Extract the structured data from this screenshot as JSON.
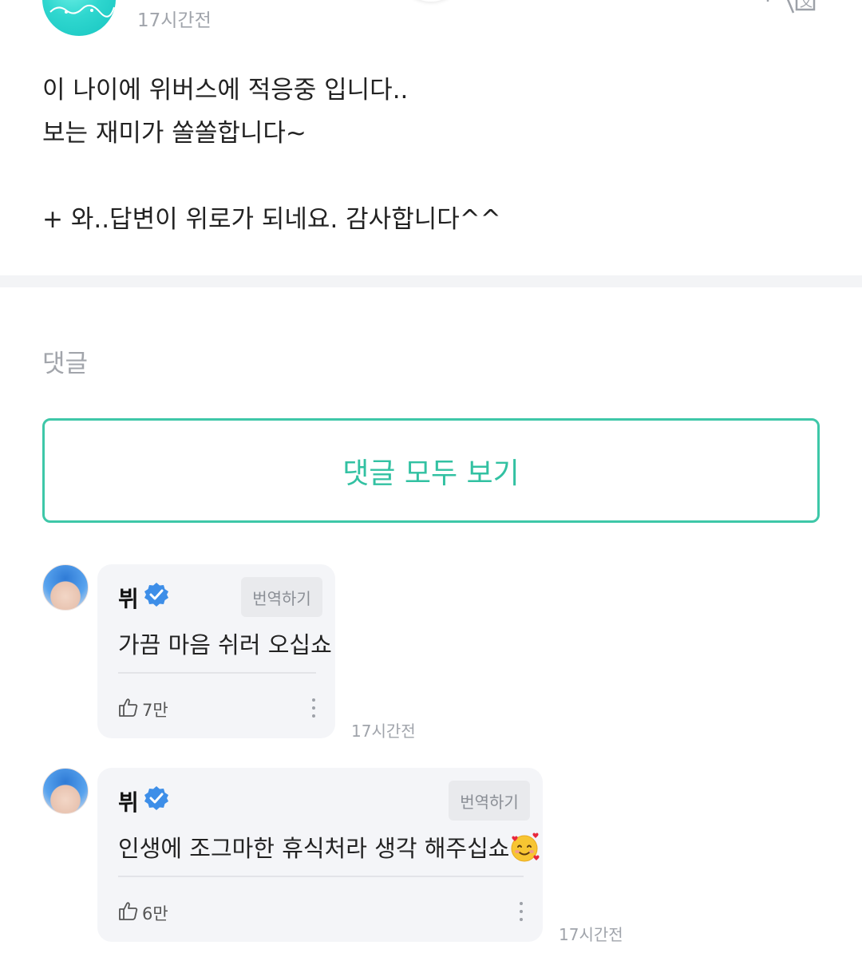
{
  "post": {
    "time": "17시간전",
    "body_lines": [
      "이 나이에 위버스에 적응중 입니다..",
      "보는 재미가 쏠쏠합니다~",
      "",
      "+ 와..답변이 위로가 되네요. 감사합니다^^"
    ]
  },
  "comments_section": {
    "heading": "댓글",
    "view_all_label": "댓글 모두 보기"
  },
  "comments": [
    {
      "author": "뷔",
      "verified": true,
      "translate_label": "번역하기",
      "text": "가끔 마음 쉬러 오십쇼",
      "likes": "7만",
      "time": "17시간전"
    },
    {
      "author": "뷔",
      "verified": true,
      "translate_label": "번역하기",
      "text": "인생에 조그마한 휴식처라 생각 해주십쇼",
      "emoji": "smiling-face-with-hearts",
      "likes": "6만",
      "time": "17시간전"
    }
  ],
  "colors": {
    "accent": "#32c1a2",
    "card_bg": "#f4f5f8",
    "muted_text": "#a0a4ab",
    "verified_blue": "#3d8ee8"
  }
}
